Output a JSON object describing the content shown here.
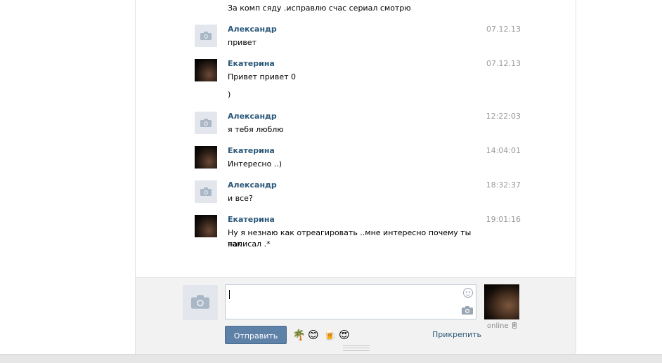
{
  "top_message": "За комп сяду .исправлю счас сериал смотрю",
  "messages": [
    {
      "author": "Александр",
      "time": "07.12.13",
      "avatar": "camera-placeholder",
      "lines": [
        "привет"
      ]
    },
    {
      "author": "Екатерина",
      "time": "07.12.13",
      "avatar": "photo",
      "lines": [
        "Привет привет 0",
        ")"
      ]
    },
    {
      "author": "Александр",
      "time": "12:22:03",
      "avatar": "camera-placeholder",
      "lines": [
        "я тебя люблю"
      ]
    },
    {
      "author": "Екатерина",
      "time": "14:04:01",
      "avatar": "photo",
      "lines": [
        "Интересно ..)"
      ]
    },
    {
      "author": "Александр",
      "time": "18:32:37",
      "avatar": "camera-placeholder",
      "lines": [
        "и все?"
      ]
    },
    {
      "author": "Екатерина",
      "time": "19:01:16",
      "avatar": "photo",
      "lines": [
        "Ну я незнаю как отреагировать ..мне интересно почему ты так",
        "написал .*"
      ]
    }
  ],
  "composer": {
    "input_value": "",
    "send_label": "Отправить",
    "attach_label": "Прикрепить",
    "emojis": [
      "🌴",
      "😊",
      "🍺",
      "😍"
    ],
    "friend_status": "online"
  },
  "colors": {
    "author_link": "#2b587a",
    "send_button": "#5e81a8",
    "time": "#999999"
  }
}
